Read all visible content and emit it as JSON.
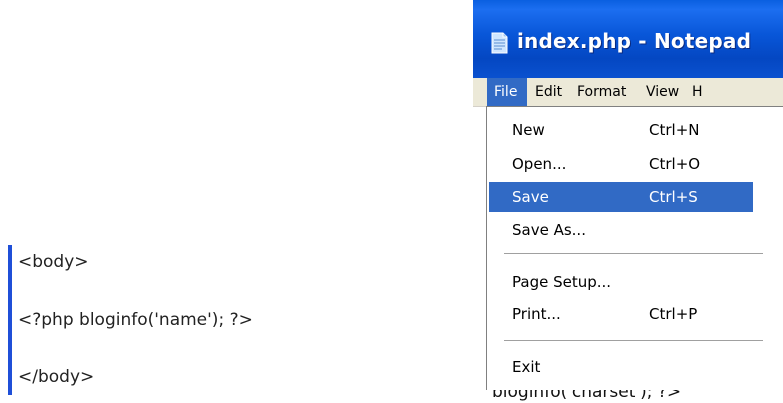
{
  "code_snippet": {
    "lines": [
      "<body>",
      "<?php bloginfo('name'); ?>",
      "</body>"
    ]
  },
  "notepad": {
    "title": "index.php - Notepad",
    "menubar": {
      "file": "File",
      "edit": "Edit",
      "format": "Format",
      "view": "View",
      "help": "H"
    },
    "file_menu": {
      "new": {
        "label": "New",
        "shortcut": "Ctrl+N"
      },
      "open": {
        "label": "Open...",
        "shortcut": "Ctrl+O"
      },
      "save": {
        "label": "Save",
        "shortcut": "Ctrl+S"
      },
      "save_as": {
        "label": "Save As..."
      },
      "page_setup": {
        "label": "Page Setup..."
      },
      "print": {
        "label": "Print...",
        "shortcut": "Ctrl+P"
      },
      "exit": {
        "label": "Exit"
      }
    },
    "background_text": "bloginfo('charset'); ?>"
  },
  "colors": {
    "titlebar_blue": "#0856d8",
    "highlight": "#316ac5",
    "menubar_bg": "#ece9d8",
    "code_bar": "#1f4fd8"
  }
}
